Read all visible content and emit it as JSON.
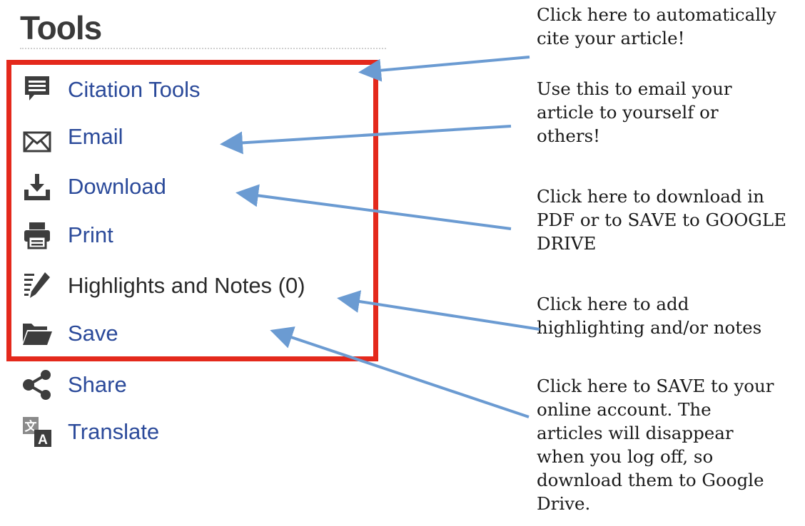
{
  "panel": {
    "title": "Tools",
    "items": [
      {
        "id": "citation",
        "icon": "speech-bubble-icon",
        "label": "Citation Tools"
      },
      {
        "id": "email",
        "icon": "envelope-icon",
        "label": "Email"
      },
      {
        "id": "download",
        "icon": "download-icon",
        "label": "Download"
      },
      {
        "id": "print",
        "icon": "printer-icon",
        "label": "Print"
      },
      {
        "id": "highlights",
        "icon": "pencil-notes-icon",
        "label": "Highlights and Notes (0)"
      },
      {
        "id": "save",
        "icon": "folder-icon",
        "label": "Save"
      },
      {
        "id": "share",
        "icon": "share-icon",
        "label": "Share"
      },
      {
        "id": "translate",
        "icon": "translate-icon",
        "label": "Translate"
      }
    ]
  },
  "annotations": [
    {
      "target": "citation",
      "lines": [
        "Click here to automatically",
        "cite your article!"
      ]
    },
    {
      "target": "email",
      "lines": [
        "Use this to email your",
        "article to yourself or",
        "others!"
      ]
    },
    {
      "target": "download",
      "lines": [
        "Click here to download in",
        "PDF or to SAVE to GOOGLE",
        "DRIVE"
      ]
    },
    {
      "target": "highlights",
      "lines": [
        "Click here to add",
        "highlighting and/or notes"
      ]
    },
    {
      "target": "save",
      "lines": [
        "Click here to SAVE to your",
        "online account.  The",
        "articles will disappear",
        "when you log off, so",
        "download them to Google",
        "Drive."
      ]
    }
  ],
  "colors": {
    "highlight_border": "#e4291c",
    "link": "#2b4a9a",
    "arrow": "#6b9bd2",
    "icon": "#3d3d3d"
  }
}
